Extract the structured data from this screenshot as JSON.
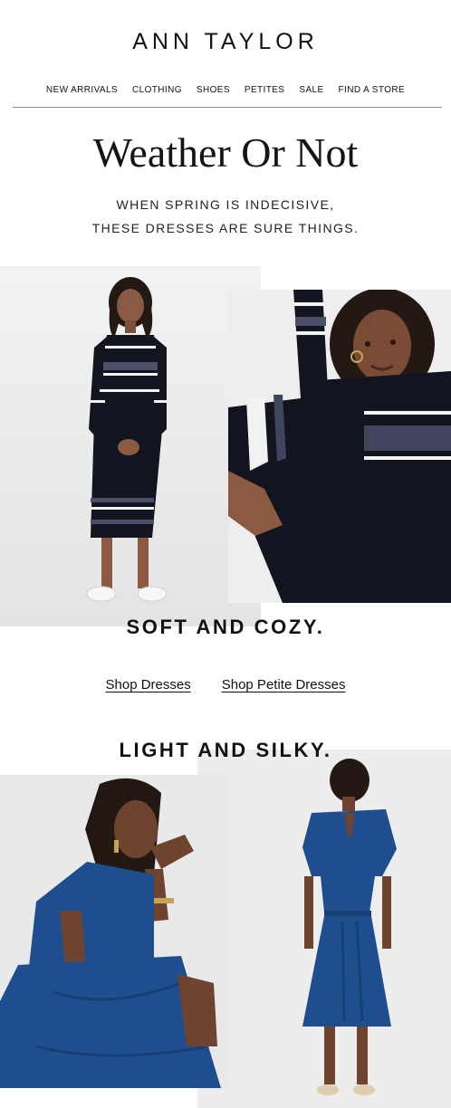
{
  "brand": {
    "name": "ANN TAYLOR"
  },
  "nav": [
    {
      "label": "NEW ARRIVALS"
    },
    {
      "label": "CLOTHING"
    },
    {
      "label": "SHOES"
    },
    {
      "label": "PETITES"
    },
    {
      "label": "SALE"
    },
    {
      "label": "FIND A STORE"
    }
  ],
  "hero": {
    "headline": "Weather Or Not",
    "sub_line_1": "WHEN SPRING IS INDECISIVE,",
    "sub_line_2": "THESE DRESSES ARE SURE THINGS."
  },
  "section_1": {
    "title": "SOFT AND COZY.",
    "link_1": "Shop Dresses",
    "link_2": "Shop Petite Dresses"
  },
  "section_2": {
    "title": "LIGHT AND SILKY."
  },
  "colors": {
    "text": "#111111",
    "knit_navy": "#12151f",
    "knit_stripe": "#f2f2f2",
    "silk_blue": "#1f4e8f",
    "skin": "#6e4330",
    "hair": "#231812",
    "backdrop": "#ececec"
  }
}
